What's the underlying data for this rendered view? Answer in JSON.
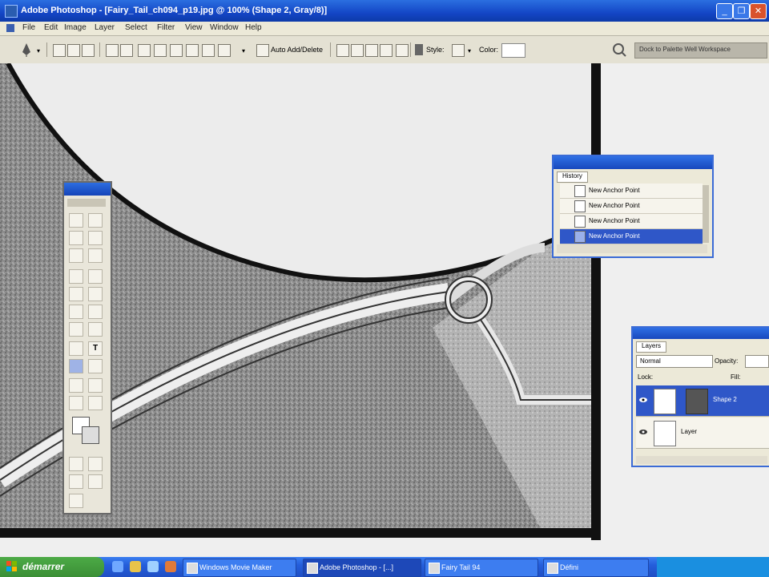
{
  "window": {
    "title": "Adobe Photoshop - [Fairy_Tail_ch094_p19.jpg @ 100% (Shape 2, Gray/8)]",
    "icon": "photoshop-icon",
    "controls": [
      "minimize-icon",
      "restore-icon",
      "close-icon"
    ]
  },
  "menu": [
    "File",
    "Edit",
    "Image",
    "Layer",
    "Select",
    "Filter",
    "View",
    "Window",
    "Help"
  ],
  "options_bar": {
    "tool_icon": "pen-icon",
    "auto_add_delete_label": "Auto Add/Delete",
    "style_label": "Style:",
    "color_label": "Color:",
    "color_value": "#ffffff",
    "workspace_label": "Dock to Palette Well   Workspace"
  },
  "history": {
    "tab": "History",
    "items": [
      {
        "label": "New Anchor Point",
        "selected": false
      },
      {
        "label": "New Anchor Point",
        "selected": false
      },
      {
        "label": "New Anchor Point",
        "selected": false
      },
      {
        "label": "New Anchor Point",
        "selected": true
      }
    ]
  },
  "layers": {
    "tab": "Layers",
    "blend_mode": "Normal",
    "opacity_label": "Opacity:",
    "lock_label": "Lock:",
    "fill_label": "Fill:",
    "items": [
      {
        "name": "Shape 2",
        "selected": true
      },
      {
        "name": "Layer",
        "selected": false
      }
    ]
  },
  "taskbar": {
    "start_label": "démarrer",
    "tasks": [
      {
        "label": "Windows Movie Maker",
        "active": false
      },
      {
        "label": "Adobe Photoshop - [...]",
        "active": true
      },
      {
        "label": "Fairy Tail 94",
        "active": false
      },
      {
        "label": "Défini",
        "active": false
      }
    ]
  },
  "colors": {
    "titlebar": "#1446c6",
    "selection": "#2f57c8",
    "taskbar": "#245edb",
    "start_button": "#3b8f36"
  }
}
